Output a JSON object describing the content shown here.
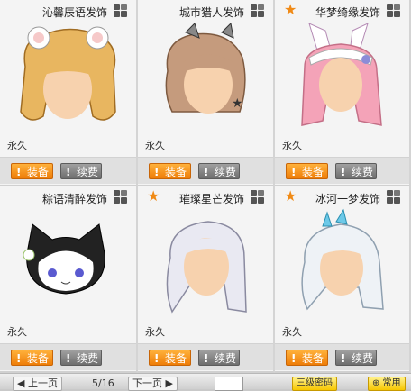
{
  "items": [
    {
      "name": "沁馨辰语发饰",
      "starred": false,
      "duration": "永久",
      "equip_label": "装备",
      "renew_label": "续费"
    },
    {
      "name": "城市猎人发饰",
      "starred": false,
      "duration": "永久",
      "equip_label": "装备",
      "renew_label": "续费"
    },
    {
      "name": "华梦绮缘发饰",
      "starred": true,
      "duration": "永久",
      "equip_label": "装备",
      "renew_label": "续费"
    },
    {
      "name": "粽语清醉发饰",
      "starred": false,
      "duration": "永久",
      "equip_label": "装备",
      "renew_label": "续费"
    },
    {
      "name": "璀璨星芒发饰",
      "starred": true,
      "duration": "永久",
      "equip_label": "装备",
      "renew_label": "续费"
    },
    {
      "name": "冰河一梦发饰",
      "starred": true,
      "duration": "永久",
      "equip_label": "装备",
      "renew_label": "续费"
    }
  ],
  "pagination": {
    "prev_label": "◀ 上一页",
    "page_info": "5/16",
    "next_label": "下一页 ▶"
  },
  "footer": {
    "btn1_label": "三级密码",
    "btn2_label": "⊕ 常用"
  },
  "colors": {
    "equip": "#ee7d08",
    "renew": "#6e6e6e",
    "star": "#f08a16"
  }
}
